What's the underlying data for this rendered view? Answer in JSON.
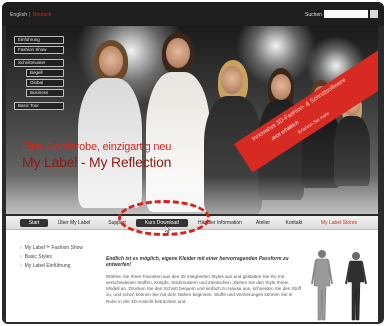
{
  "header": {
    "lang_english": "English",
    "lang_separator": "|",
    "lang_deutsch": "Deutsch",
    "search_label": "Suchen",
    "search_value": ""
  },
  "hero": {
    "menu": [
      {
        "label": "Einführung"
      },
      {
        "label": "Fashion Show"
      },
      {
        "label": "Schnittmuster"
      },
      {
        "label": "Begell"
      },
      {
        "label": "Global"
      },
      {
        "label": "Business"
      },
      {
        "label": "Basic Tour"
      }
    ],
    "headline": "Eine Garderobe, einzigartig neu",
    "subline": "My Label - My Reflection",
    "ribbon": {
      "line1": "Innovative 3D-Fashion- & Schnittsoftware",
      "line2": "Jetzt erhältlich",
      "line3": "Erfahren Sie mehr"
    }
  },
  "nav": [
    {
      "label": "Start"
    },
    {
      "label": "Über My Label"
    },
    {
      "label": "Support"
    },
    {
      "label": "Kurs Download"
    },
    {
      "label": "Händler Information"
    },
    {
      "label": "Atelier"
    },
    {
      "label": "Kontakt"
    },
    {
      "label": "My Label Stores"
    }
  ],
  "sidebar_links": [
    {
      "label": "My Label™ Fashion Show"
    },
    {
      "label": "Basic Styles"
    },
    {
      "label": "My Label Einführung"
    }
  ],
  "article": {
    "title": "Endlich ist es möglich, eigene Kleider mit einer hervorragenden Passform zu entwerfen!",
    "body": "Wählen Sie Ihren Favoriten aus den 25 integrierten Styles aus und gestalten Sie ihn mit verschiedenen Stoffen, Knöpfe, Stickmustern und Zierstichen. Ziehen Sie den Style Ihrem Modell an. Drucken Sie den Schnitt bequem und einfach zu Hause aus, schneiden Sie den Stoff zu, und schon können Sie mit dem Nähen beginnen. Stoffe und Verzierungen können Sie in Ruhe in der 3D-Ansicht betrachten und"
  },
  "colors": {
    "accent_red": "#d7261e",
    "annotation_red": "#e01f14",
    "dark": "#2a2a2a"
  }
}
